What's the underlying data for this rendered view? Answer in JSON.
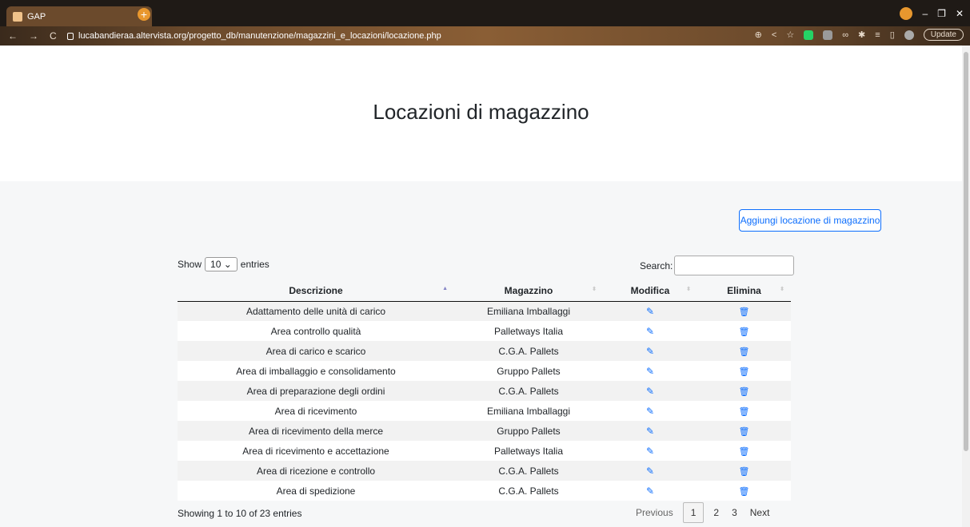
{
  "browser": {
    "tab_title": "GAP",
    "tab_close": "×",
    "new_tab": "+",
    "url": "lucabandieraa.altervista.org/progetto_db/manutenzione/magazzini_e_locazioni/locazione.php",
    "update_label": "Update"
  },
  "page": {
    "title": "Locazioni di magazzino",
    "add_button": "Aggiungi locazione di magazzino",
    "show_label": "Show",
    "entries_value": "10",
    "entries_label": "entries",
    "search_label": "Search:",
    "search_value": ""
  },
  "table": {
    "headers": [
      "Descrizione",
      "Magazzino",
      "Modifica",
      "Elimina"
    ],
    "rows": [
      {
        "descrizione": "Adattamento delle unità di carico",
        "magazzino": "Emiliana Imballaggi"
      },
      {
        "descrizione": "Area controllo qualità",
        "magazzino": "Palletways Italia"
      },
      {
        "descrizione": "Area di carico e scarico",
        "magazzino": "C.G.A. Pallets"
      },
      {
        "descrizione": "Area di imballaggio e consolidamento",
        "magazzino": "Gruppo Pallets"
      },
      {
        "descrizione": "Area di preparazione degli ordini",
        "magazzino": "C.G.A. Pallets"
      },
      {
        "descrizione": "Area di ricevimento",
        "magazzino": "Emiliana Imballaggi"
      },
      {
        "descrizione": "Area di ricevimento della merce",
        "magazzino": "Gruppo Pallets"
      },
      {
        "descrizione": "Area di ricevimento e accettazione",
        "magazzino": "Palletways Italia"
      },
      {
        "descrizione": "Area di ricezione e controllo",
        "magazzino": "C.G.A. Pallets"
      },
      {
        "descrizione": "Area di spedizione",
        "magazzino": "C.G.A. Pallets"
      }
    ]
  },
  "footer": {
    "info": "Showing 1 to 10 of 23 entries",
    "previous": "Previous",
    "pages": [
      "1",
      "2",
      "3"
    ],
    "next": "Next"
  }
}
